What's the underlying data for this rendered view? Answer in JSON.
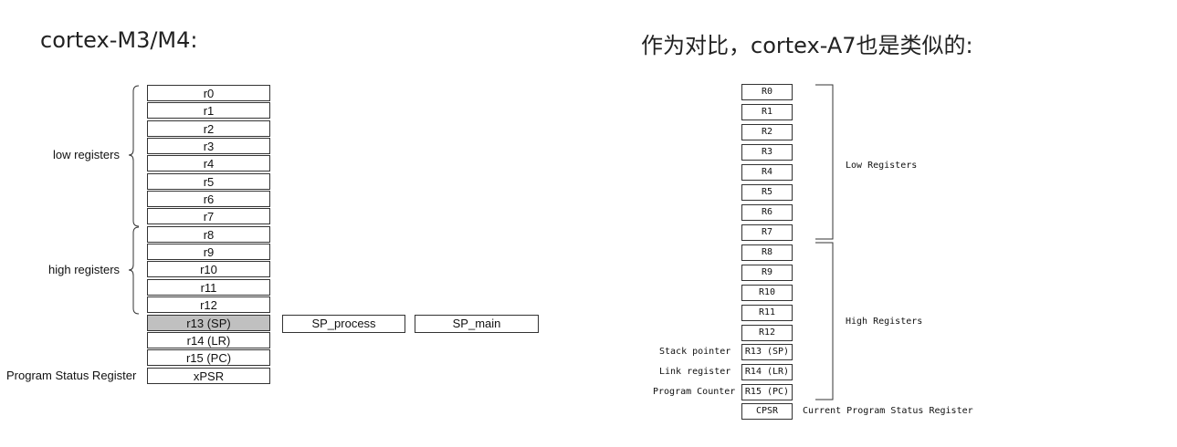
{
  "left": {
    "heading": "cortex-M3/M4:",
    "registers": [
      "r0",
      "r1",
      "r2",
      "r3",
      "r4",
      "r5",
      "r6",
      "r7",
      "r8",
      "r9",
      "r10",
      "r11",
      "r12",
      "r13 (SP)",
      "r14 (LR)",
      "r15 (PC)",
      "xPSR"
    ],
    "sp_banked": [
      "SP_process",
      "SP_main"
    ],
    "groups": {
      "low": "low registers",
      "high": "high registers"
    },
    "psr_label": "Program Status Register"
  },
  "right": {
    "heading": "作为对比，cortex-A7也是类似的:",
    "registers": [
      "R0",
      "R1",
      "R2",
      "R3",
      "R4",
      "R5",
      "R6",
      "R7",
      "R8",
      "R9",
      "R10",
      "R11",
      "R12",
      "R13 (SP)",
      "R14 (LR)",
      "R15 (PC)",
      "CPSR"
    ],
    "groups": {
      "low": "Low Registers",
      "high": "High Registers"
    },
    "side_labels": {
      "sp": "Stack pointer",
      "lr": "Link register",
      "pc": "Program Counter"
    },
    "cpsr_label": "Current Program Status Register"
  }
}
